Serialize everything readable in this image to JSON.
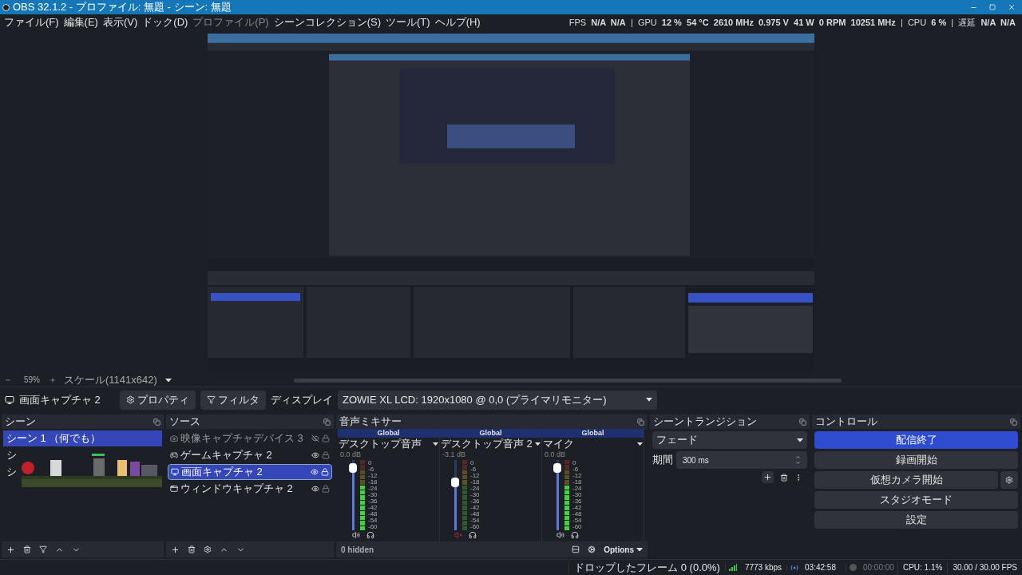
{
  "window": {
    "title": "OBS 32.1.2 - プロファイル: 無題 - シーン: 無題"
  },
  "menu": [
    {
      "label": "ファイル(F)",
      "disabled": false
    },
    {
      "label": "編集(E)",
      "disabled": false
    },
    {
      "label": "表示(V)",
      "disabled": false
    },
    {
      "label": "ドック(D)",
      "disabled": false
    },
    {
      "label": "プロファイル(P)",
      "disabled": true
    },
    {
      "label": "シーンコレクション(S)",
      "disabled": false
    },
    {
      "label": "ツール(T)",
      "disabled": false
    },
    {
      "label": "ヘルプ(H)",
      "disabled": false
    }
  ],
  "stats": "FPS  **N/A  N/A**  |  GPU  **12 %  54 °C  2610 MHz  0.975 V  41 W  0 RPM  10251 MHz**  |  CPU  **6 %**  |  遅延  **N/A  N/A**",
  "preview": {
    "kind": "picture",
    "zoom": "59%",
    "scale": "スケール(1141x642)"
  },
  "source_bar": {
    "name": "画面キャプチャ 2",
    "properties": "プロパティ",
    "filters": "フィルタ",
    "display_label": "ディスプレイ",
    "display_value": "ZOWIE XL LCD: 1920x1080 @ 0,0 (プライマリモニター)"
  },
  "scenes": {
    "title": "シーン",
    "items": [
      {
        "name": "シーン 1 （何でも）",
        "selected": true
      },
      {
        "name": "シ",
        "selected": false
      },
      {
        "name": "シ",
        "selected": false
      }
    ]
  },
  "sources": {
    "title": "ソース",
    "items": [
      {
        "name": "映像キャプチャデバイス 3",
        "kind": "camera",
        "visible": false,
        "selected": false
      },
      {
        "name": "ゲームキャプチャ 2",
        "kind": "game",
        "visible": true,
        "selected": false
      },
      {
        "name": "画面キャプチャ 2",
        "kind": "display",
        "visible": true,
        "selected": true
      },
      {
        "name": "ウィンドウキャプチャ 2",
        "kind": "window",
        "visible": true,
        "selected": false
      }
    ]
  },
  "mixer": {
    "title": "音声ミキサー",
    "channels": [
      {
        "tag": "Global",
        "name": "デスクトップ音声",
        "reading": "0.0 dB",
        "level": 0.95,
        "muted": false,
        "scale": [
          "0",
          "-6",
          "-12",
          "-18",
          "-24",
          "-30",
          "-36",
          "-42",
          "-48",
          "-54",
          "-60"
        ]
      },
      {
        "tag": "Global",
        "name": "デスクトップ音声 2",
        "reading": "-3.1 dB",
        "level": 0.75,
        "muted": true,
        "scale": [
          "0",
          "-6",
          "-12",
          "-18",
          "-24",
          "-30",
          "-36",
          "-42",
          "-48",
          "-54",
          "-60"
        ]
      },
      {
        "tag": "Global",
        "name": "マイク",
        "reading": "0.0 dB",
        "level": 0.95,
        "muted": false,
        "scale": [
          "0",
          "-6",
          "-12",
          "-18",
          "-24",
          "-30",
          "-36",
          "-42",
          "-48",
          "-54",
          "-60"
        ]
      }
    ],
    "hidden": "0 hidden",
    "options": "Options"
  },
  "transitions": {
    "title": "シーントランジション",
    "type": "フェード",
    "duration_label": "期間",
    "duration": "300 ms"
  },
  "controls": {
    "title": "コントロール",
    "buttons": [
      {
        "label": "配信終了",
        "active": true,
        "gear": false
      },
      {
        "label": "録画開始",
        "active": false,
        "gear": false
      },
      {
        "label": "仮想カメラ開始",
        "active": false,
        "gear": true
      },
      {
        "label": "スタジオモード",
        "active": false,
        "gear": false
      },
      {
        "label": "設定",
        "active": false,
        "gear": false
      }
    ]
  },
  "status": {
    "dropped": "ドロップしたフレーム 0 (0.0%)",
    "bitrate": "7773 kbps",
    "stream_time": "03:42:58",
    "record_time": "00:00:00",
    "cpu": "CPU: 1.1%",
    "fps": "30.00 / 30.00 FPS"
  }
}
